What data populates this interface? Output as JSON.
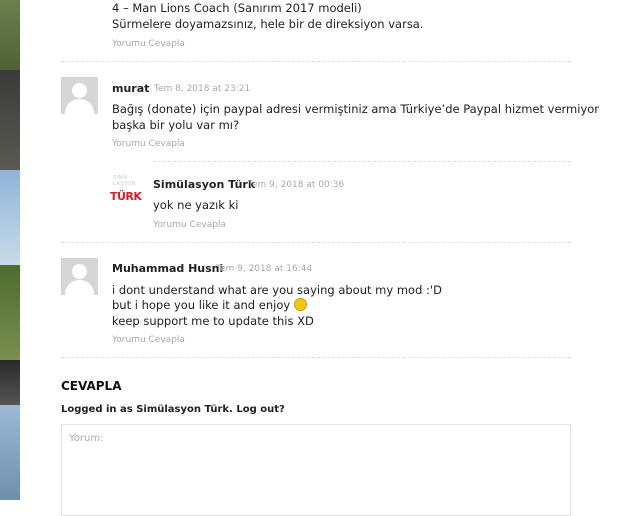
{
  "comments": [
    {
      "lines": [
        "4 – Man Lions Coach (Sanırım 2017 modeli)",
        "Sürmelere doyamazsınız, hele bir de direksiyon varsa."
      ],
      "reply_label": "Yorumu Cevapla"
    },
    {
      "author": "murat",
      "date": "Tem 8, 2018 at 23:21",
      "lines": [
        "Bağış (donate) için paypal adresi vermiştiniz ama Türkiye’de Paypal hizmet vermiyor",
        "başka bir yolu var mı?"
      ],
      "reply_label": "Yorumu Cevapla"
    },
    {
      "author": "Simülasyon Türk",
      "date": "Tem 9, 2018 at 00:36",
      "lines": [
        "yok ne yazık ki"
      ],
      "reply_label": "Yorumu Cevapla",
      "logo_small": "SİMÜ\nLASYON",
      "logo_text": "TÜRK"
    },
    {
      "author": "Muhammad Husni",
      "date": "Tem 9, 2018 at 16:44",
      "lines": [
        "i dont understand what are you saying about my mod :'D",
        "but i hope you like it and enjoy",
        "keep support me to update this XD"
      ],
      "reply_label": "Yorumu Cevapla"
    }
  ],
  "reply_form": {
    "title": "CEVAPLA",
    "logged_in": "Logged in as Simülasyon Türk. Log out?",
    "placeholder": "Yorum:"
  },
  "colors": {
    "accent_red": "#d81f26",
    "meta_gray": "#aaaaaa"
  }
}
